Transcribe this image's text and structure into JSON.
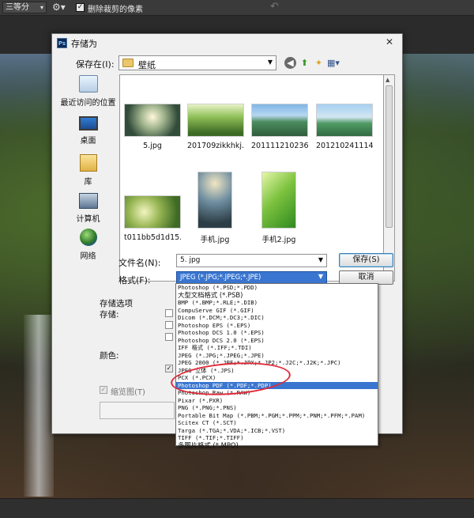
{
  "toolbar": {
    "ratio_select": "三等分",
    "delete_cropped_checked": true,
    "delete_cropped_label": "删除裁剪的像素"
  },
  "dialog": {
    "title": "存储为",
    "app_icon_text": "Ps",
    "save_in_label": "保存在(I):",
    "save_in_value": "壁纸",
    "places": [
      {
        "label": "最近访问的位置",
        "icon": "recent-places-icon"
      },
      {
        "label": "桌面",
        "icon": "desktop-icon"
      },
      {
        "label": "库",
        "icon": "library-icon"
      },
      {
        "label": "计算机",
        "icon": "computer-icon"
      },
      {
        "label": "网络",
        "icon": "network-icon"
      }
    ],
    "files": [
      {
        "name": "5.jpg"
      },
      {
        "name": "201709zikkhkj..."
      },
      {
        "name": "2011112102362..."
      },
      {
        "name": "2012102411148..."
      },
      {
        "name": "t011bb5d1d15..."
      },
      {
        "name": "手机.jpg"
      },
      {
        "name": "手机2.jpg"
      }
    ],
    "filename_label": "文件名(N):",
    "filename_value": "5. jpg",
    "format_label": "格式(F):",
    "format_value": "JPEG (*.JPG;*.JPEG;*.JPE)",
    "save_button": "保存(S)",
    "cancel_button": "取消",
    "options_title": "存储选项",
    "options_save_label": "存储:",
    "color_label": "颜色:",
    "thumbnail_label": "缩览图(T)",
    "format_options": [
      "Photoshop (*.PSD;*.PDD)",
      "大型文档格式 (*.PSB)",
      "BMP (*.BMP;*.RLE;*.DIB)",
      "CompuServe GIF (*.GIF)",
      "Dicom (*.DCM;*.DC3;*.DIC)",
      "Photoshop EPS (*.EPS)",
      "Photoshop DCS 1.0 (*.EPS)",
      "Photoshop DCS 2.0 (*.EPS)",
      "IFF 格式 (*.IFF;*.TDI)",
      "JPEG (*.JPG;*.JPEG;*.JPE)",
      "JPEG 2000 (*.JPF;*.JPX;*.JP2;*.J2C;*.J2K;*.JPC)",
      "JPEG 立体 (*.JPS)",
      "PCX (*.PCX)",
      "Photoshop PDF (*.PDF;*.PDP)",
      "Photoshop Raw (*.RAW)",
      "Pixar (*.PXR)",
      "PNG (*.PNG;*.PNS)",
      "Portable Bit Map (*.PBM;*.PGM;*.PPM;*.PNM;*.PFM;*.PAM)",
      "Scitex CT (*.SCT)",
      "Targa (*.TGA;*.VDA;*.ICB;*.VST)",
      "TIFF (*.TIF;*.TIFF)",
      "多图片格式 (*.MPO)"
    ],
    "selected_format_index": 13
  }
}
